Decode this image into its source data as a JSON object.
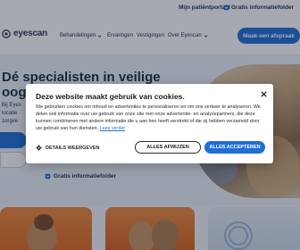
{
  "utility": {
    "portal": "Mijn patiëntportaal",
    "folder": "Gratis informatiefolder"
  },
  "header": {
    "logo_text": "eyescan",
    "nav": [
      "Behandelingen",
      "Ervaringen",
      "Vestigingen",
      "Over Eyescan"
    ],
    "cta": "Maak een afspraak"
  },
  "hero": {
    "title_line1": "Dé specialisten in veilige",
    "title_line2": "oog",
    "para_1": "Bij Eyes",
    "para_2": "locatie",
    "para_3": "zorgve",
    "folder_link": "Gratis informatiefolder"
  },
  "cookie": {
    "title": "Deze website maakt gebruik van cookies.",
    "body": "We gebruiken cookies om inhoud en advertenties te personaliseren en om ons verkeer te analyseren. We delen ook informatie over uw gebruik van onze site met onze advertentie- en analysepartners, die deze kunnen combineren met andere informatie die u aan hen heeft verstrekt of die zij hebben verzameld door uw gebruik van hun diensten.",
    "link": "Lees verder",
    "details": "DETAILS WEERGEVEN",
    "reject": "ALLES AFWIJZEN",
    "accept": "ALLES ACCEPTEREN"
  },
  "colors": {
    "brand_blue": "#1f6fd6",
    "navy": "#1c2d4a",
    "orange": "#ef8a3a"
  },
  "icons": [
    "user-icon",
    "folder-icon",
    "chevron-down-icon",
    "close-icon",
    "gear-icon",
    "logo-mark-icon"
  ]
}
